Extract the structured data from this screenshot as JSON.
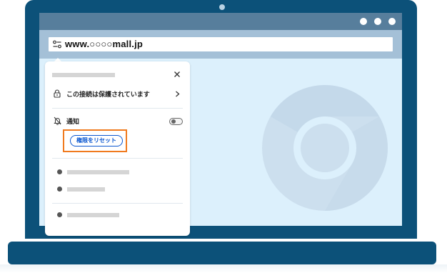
{
  "browser": {
    "url": "www.○○○○mall.jp"
  },
  "site_info_popup": {
    "connection_label": "この接続は保護されています",
    "notifications_label": "通知",
    "notifications_enabled": false,
    "reset_permissions_button": "権限をリセット",
    "highlight_color": "#f07a1e",
    "accent_color": "#0b57d0"
  },
  "colors": {
    "frame": "#0c5179",
    "titlebar": "#577e9c",
    "toolbar": "#a4c0d7",
    "content": "#dcf0fc"
  },
  "icons": [
    "tune-icon",
    "close-icon",
    "lock-icon",
    "chevron-right-icon",
    "notifications-off-icon",
    "chrome-logo"
  ]
}
